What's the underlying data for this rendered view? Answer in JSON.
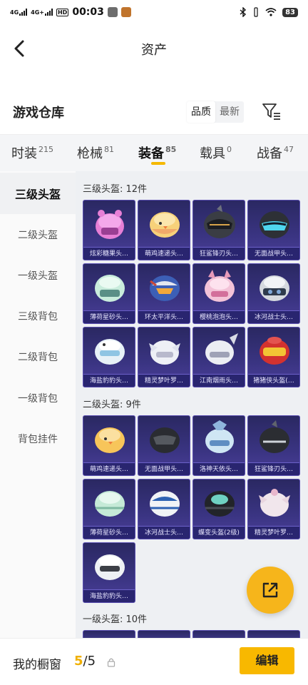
{
  "status_bar": {
    "signal_1": "4G",
    "signal_2": "4G+",
    "hd_badge": "HD",
    "time": "00:03",
    "battery": "83"
  },
  "header": {
    "title": "资产"
  },
  "warehouse": {
    "title": "游戏仓库",
    "sort_quality": "品质",
    "sort_newest": "最新"
  },
  "tabs": [
    {
      "label": "时装",
      "count": "215"
    },
    {
      "label": "枪械",
      "count": "81"
    },
    {
      "label": "装备",
      "count": "85"
    },
    {
      "label": "载具",
      "count": "0"
    },
    {
      "label": "战备",
      "count": "47"
    }
  ],
  "active_tab": "装备",
  "sidebar": {
    "items": [
      {
        "label": "三级头盔"
      },
      {
        "label": "二级头盔"
      },
      {
        "label": "一级头盔"
      },
      {
        "label": "三级背包"
      },
      {
        "label": "二级背包"
      },
      {
        "label": "一级背包"
      },
      {
        "label": "背包挂件"
      }
    ],
    "active": "三级头盔"
  },
  "sections": [
    {
      "title": "三级头盔: 12件",
      "items": [
        {
          "name": "炫彩糖果头…",
          "icon": "pink-candy-helmet"
        },
        {
          "name": "萌鸡速递头…",
          "icon": "chick-helmet"
        },
        {
          "name": "狂鲨锋刃头…",
          "icon": "shark-helmet"
        },
        {
          "name": "无面战甲头…",
          "icon": "faceless-armor-helmet"
        },
        {
          "name": "薄荷星砂头…",
          "icon": "mint-helmet"
        },
        {
          "name": "环太平洋头…",
          "icon": "pacific-rim-helmet"
        },
        {
          "name": "樱桃泡泡头…",
          "icon": "cherry-bubble-helmet"
        },
        {
          "name": "冰河战士头…",
          "icon": "glacier-warrior-helmet"
        },
        {
          "name": "海盐豹豹头…",
          "icon": "sea-salt-leopard-helmet"
        },
        {
          "name": "精灵梦叶罗…",
          "icon": "elf-dream-helmet"
        },
        {
          "name": "江南烟雨头…",
          "icon": "jiangnan-rain-helmet"
        },
        {
          "name": "猪猪侠头盔(…",
          "icon": "gg-bond-helmet"
        }
      ]
    },
    {
      "title": "二级头盔: 9件",
      "items": [
        {
          "name": "萌鸡速递头…",
          "icon": "chick-helmet"
        },
        {
          "name": "无面战甲头…",
          "icon": "faceless-armor-helmet"
        },
        {
          "name": "洛神天依头…",
          "icon": "luo-tianyi-helmet"
        },
        {
          "name": "狂鲨锋刃头…",
          "icon": "shark-helmet"
        },
        {
          "name": "薄荷星砂头…",
          "icon": "mint-helmet"
        },
        {
          "name": "冰河战士头…",
          "icon": "glacier-warrior-helmet"
        },
        {
          "name": "蝶变头盔(2级)",
          "icon": "butterfly-helmet"
        },
        {
          "name": "精灵梦叶罗…",
          "icon": "elf-dream-helmet"
        },
        {
          "name": "海盐豹豹头…",
          "icon": "sea-salt-leopard-helmet"
        }
      ]
    },
    {
      "title": "一级头盔: 10件",
      "items": []
    }
  ],
  "bottom": {
    "window_label": "我的橱窗",
    "window_current": "5",
    "window_sep_total": "/5",
    "edit_label": "编辑"
  },
  "colors": {
    "accent": "#f8b800",
    "card_bg": "#2e2b6b",
    "card_border": "#5a4fb0"
  }
}
